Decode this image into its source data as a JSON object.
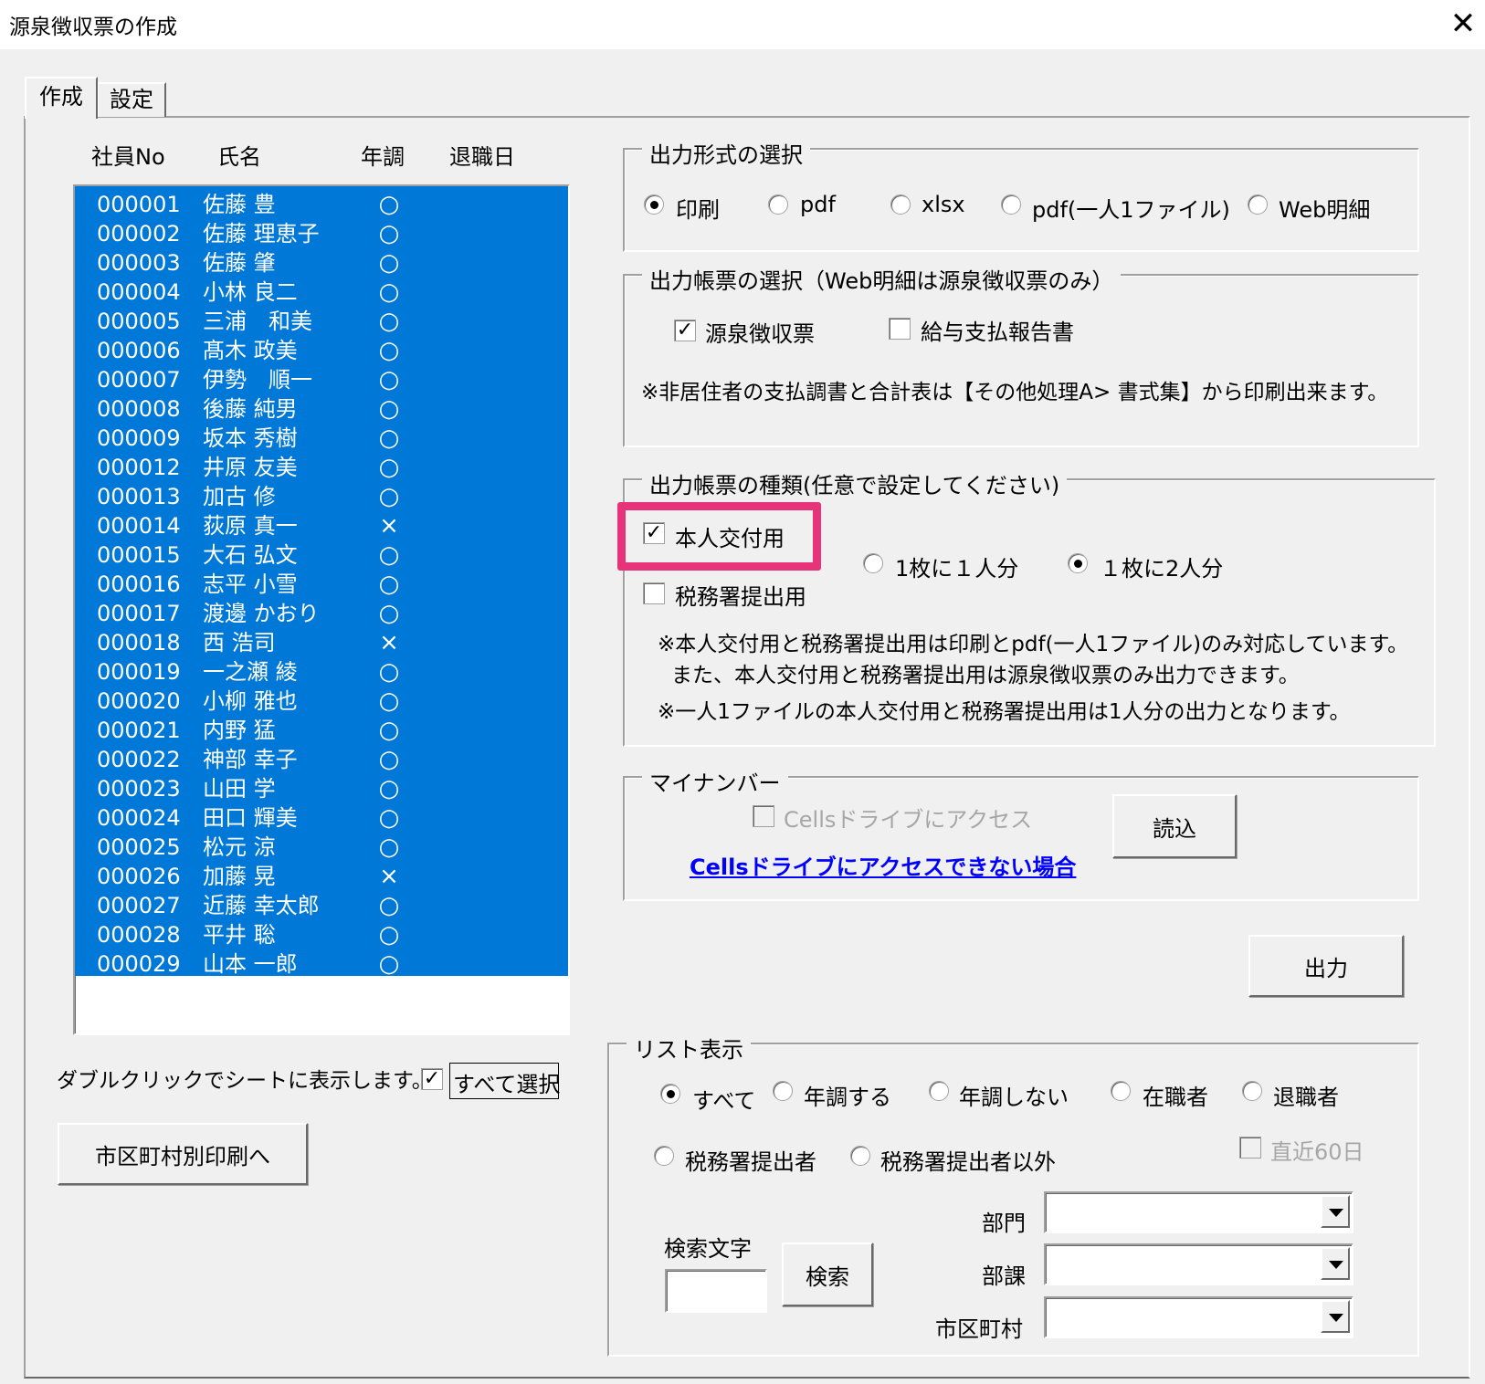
{
  "window": {
    "title": "源泉徴収票の作成",
    "close_symbol": "✕"
  },
  "tabs": [
    {
      "label": "作成"
    },
    {
      "label": "設定"
    }
  ],
  "employee_list": {
    "columns": {
      "no": "社員No",
      "name": "氏名",
      "nencho": "年調",
      "retire_date": "退職日"
    },
    "rows": [
      {
        "no": "000001",
        "name": "佐藤 豊",
        "nencho": "○"
      },
      {
        "no": "000002",
        "name": "佐藤 理恵子",
        "nencho": "○"
      },
      {
        "no": "000003",
        "name": "佐藤 肇",
        "nencho": "○"
      },
      {
        "no": "000004",
        "name": "小林 良二",
        "nencho": "○"
      },
      {
        "no": "000005",
        "name": "三浦　和美",
        "nencho": "○"
      },
      {
        "no": "000006",
        "name": "髙木 政美",
        "nencho": "○"
      },
      {
        "no": "000007",
        "name": "伊勢　順一",
        "nencho": "○"
      },
      {
        "no": "000008",
        "name": "後藤 純男",
        "nencho": "○"
      },
      {
        "no": "000009",
        "name": "坂本 秀樹",
        "nencho": "○"
      },
      {
        "no": "000012",
        "name": "井原 友美",
        "nencho": "○"
      },
      {
        "no": "000013",
        "name": "加古 修",
        "nencho": "○"
      },
      {
        "no": "000014",
        "name": "荻原 真一",
        "nencho": "×"
      },
      {
        "no": "000015",
        "name": "大石 弘文",
        "nencho": "○"
      },
      {
        "no": "000016",
        "name": "志平 小雪",
        "nencho": "○"
      },
      {
        "no": "000017",
        "name": "渡邊 かおり",
        "nencho": "○"
      },
      {
        "no": "000018",
        "name": "西 浩司",
        "nencho": "×"
      },
      {
        "no": "000019",
        "name": "一之瀬 綾",
        "nencho": "○"
      },
      {
        "no": "000020",
        "name": "小柳 雅也",
        "nencho": "○"
      },
      {
        "no": "000021",
        "name": "内野 猛",
        "nencho": "○"
      },
      {
        "no": "000022",
        "name": "神部 幸子",
        "nencho": "○"
      },
      {
        "no": "000023",
        "name": "山田 学",
        "nencho": "○"
      },
      {
        "no": "000024",
        "name": "田口 輝美",
        "nencho": "○"
      },
      {
        "no": "000025",
        "name": "松元 涼",
        "nencho": "○"
      },
      {
        "no": "000026",
        "name": "加藤 晃",
        "nencho": "×"
      },
      {
        "no": "000027",
        "name": "近藤 幸太郎",
        "nencho": "○"
      },
      {
        "no": "000028",
        "name": "平井 聡",
        "nencho": "○"
      },
      {
        "no": "000029",
        "name": "山本 一郎",
        "nencho": "○"
      }
    ],
    "hint": "ダブルクリックでシートに表示します。",
    "select_all_label": "すべて選択",
    "select_all_checked": true
  },
  "city_print_button": "市区町村別印刷へ",
  "output_format": {
    "legend": "出力形式の選択",
    "options": [
      "印刷",
      "pdf",
      "xlsx",
      "pdf(一人1ファイル)",
      "Web明細"
    ],
    "selected": "印刷"
  },
  "output_forms": {
    "legend": "出力帳票の選択（Web明細は源泉徴収票のみ）",
    "gensen_label": "源泉徴収票",
    "gensen_checked": true,
    "kyuyo_label": "給与支払報告書",
    "kyuyo_checked": false,
    "note": "※非居住者の支払調書と合計表は【その他処理A> 書式集】から印刷出来ます。"
  },
  "form_types": {
    "legend": "出力帳票の種類(任意で設定してください)",
    "honnin_label": "本人交付用",
    "honnin_checked": true,
    "zeimusho_label": "税務署提出用",
    "zeimusho_checked": false,
    "per_sheet_1": "1枚に１人分",
    "per_sheet_2": "１枚に2人分",
    "per_sheet_selected": "１枚に2人分",
    "note1": "※本人交付用と税務署提出用は印刷とpdf(一人1ファイル)のみ対応しています。",
    "note2": "また、本人交付用と税務署提出用は源泉徴収票のみ出力できます。",
    "note3": "※一人1ファイルの本人交付用と税務署提出用は1人分の出力となります。",
    "highlight_color": "#e6337a"
  },
  "my_number": {
    "legend": "マイナンバー",
    "cells_drive_label": "Cellsドライブにアクセス",
    "cells_drive_checked": false,
    "read_button": "読込",
    "link_text": "Cellsドライブにアクセスできない場合"
  },
  "output_button": "出力",
  "list_display": {
    "legend": "リスト表示",
    "filters": [
      "すべて",
      "年調する",
      "年調しない",
      "在職者",
      "退職者",
      "税務署提出者",
      "税務署提出者以外"
    ],
    "selected": "すべて",
    "recent60_label": "直近60日",
    "recent60_checked": false,
    "search_label": "検索文字",
    "search_value": "",
    "search_button": "検索",
    "dept_label": "部門",
    "section_label": "部課",
    "city_label": "市区町村",
    "dept_value": "",
    "section_value": "",
    "city_value": ""
  },
  "colors": {
    "selection": "#0078d7",
    "link": "#0000ff",
    "dialog_bg": "#f0f0f0"
  }
}
